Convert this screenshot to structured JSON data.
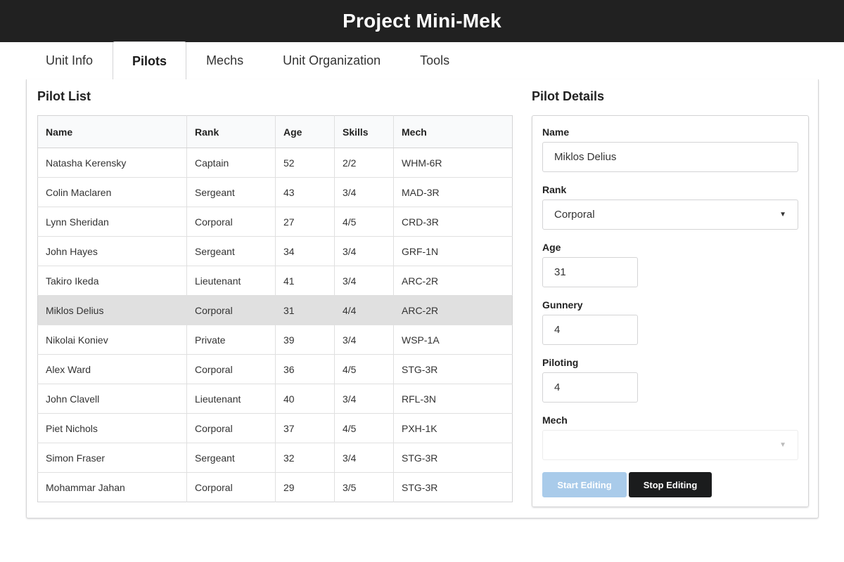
{
  "app": {
    "title": "Project Mini-Mek"
  },
  "tabs": [
    {
      "label": "Unit Info"
    },
    {
      "label": "Pilots"
    },
    {
      "label": "Mechs"
    },
    {
      "label": "Unit Organization"
    },
    {
      "label": "Tools"
    }
  ],
  "active_tab": "Pilots",
  "pilot_list": {
    "title": "Pilot List",
    "columns": [
      "Name",
      "Rank",
      "Age",
      "Skills",
      "Mech"
    ],
    "rows": [
      {
        "name": "Natasha Kerensky",
        "rank": "Captain",
        "age": "52",
        "skills": "2/2",
        "mech": "WHM-6R"
      },
      {
        "name": "Colin Maclaren",
        "rank": "Sergeant",
        "age": "43",
        "skills": "3/4",
        "mech": "MAD-3R"
      },
      {
        "name": "Lynn Sheridan",
        "rank": "Corporal",
        "age": "27",
        "skills": "4/5",
        "mech": "CRD-3R"
      },
      {
        "name": "John Hayes",
        "rank": "Sergeant",
        "age": "34",
        "skills": "3/4",
        "mech": "GRF-1N"
      },
      {
        "name": "Takiro Ikeda",
        "rank": "Lieutenant",
        "age": "41",
        "skills": "3/4",
        "mech": "ARC-2R"
      },
      {
        "name": "Miklos Delius",
        "rank": "Corporal",
        "age": "31",
        "skills": "4/4",
        "mech": "ARC-2R"
      },
      {
        "name": "Nikolai Koniev",
        "rank": "Private",
        "age": "39",
        "skills": "3/4",
        "mech": "WSP-1A"
      },
      {
        "name": "Alex Ward",
        "rank": "Corporal",
        "age": "36",
        "skills": "4/5",
        "mech": "STG-3R"
      },
      {
        "name": "John Clavell",
        "rank": "Lieutenant",
        "age": "40",
        "skills": "3/4",
        "mech": "RFL-3N"
      },
      {
        "name": "Piet Nichols",
        "rank": "Corporal",
        "age": "37",
        "skills": "4/5",
        "mech": "PXH-1K"
      },
      {
        "name": "Simon Fraser",
        "rank": "Sergeant",
        "age": "32",
        "skills": "3/4",
        "mech": "STG-3R"
      },
      {
        "name": "Mohammar Jahan",
        "rank": "Corporal",
        "age": "29",
        "skills": "3/5",
        "mech": "STG-3R"
      }
    ],
    "selected_name": "Miklos Delius"
  },
  "pilot_details": {
    "title": "Pilot Details",
    "name_label": "Name",
    "name_value": "Miklos Delius",
    "rank_label": "Rank",
    "rank_value": "Corporal",
    "age_label": "Age",
    "age_value": "31",
    "gunnery_label": "Gunnery",
    "gunnery_value": "4",
    "piloting_label": "Piloting",
    "piloting_value": "4",
    "mech_label": "Mech",
    "mech_value": "",
    "start_editing_label": "Start Editing",
    "stop_editing_label": "Stop Editing"
  },
  "colors": {
    "header_bg": "#212121",
    "selected_row": "#e0e0e0",
    "start_button_disabled": "#a9cbea",
    "stop_button": "#1b1c1d"
  }
}
